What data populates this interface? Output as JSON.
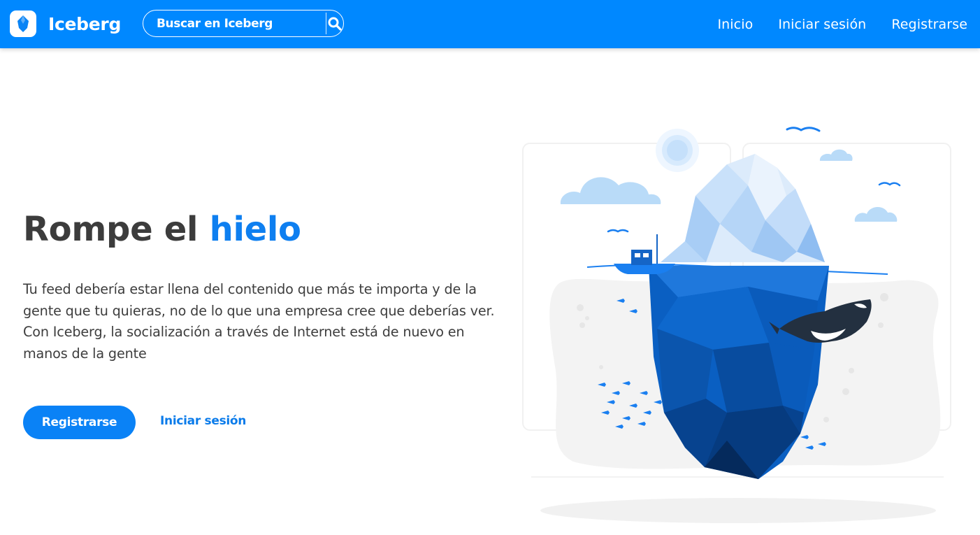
{
  "navbar": {
    "brand_name": "Iceberg",
    "logo_icon": "iceberg-logo-icon",
    "background_color": "#0088ff",
    "search": {
      "placeholder": "Buscar en Iceberg",
      "icon": "search-icon"
    },
    "links": [
      {
        "label": "Inicio"
      },
      {
        "label": "Iniciar sesión"
      },
      {
        "label": "Registrarse"
      }
    ]
  },
  "hero": {
    "title_prefix": "Rompe el",
    "title_accent": "hielo",
    "accent_color": "#0e7ff0",
    "description": "Tu feed debería estar llena del contenido que más te importa y de la gente que tu quieras, no de lo que una empresa cree que deberías ver. Con Iceberg, la socialización a través de Internet está de nuevo en manos de la gente",
    "primary_button": "Registrarse",
    "secondary_link": "Iniciar sesión"
  },
  "illustration": {
    "subject": "iceberg-illustration",
    "colors": {
      "ice_light": "#dcebfb",
      "ice_mid": "#b5d5f7",
      "water_deep": "#0a5fc2",
      "water_dark": "#063b7f",
      "sky_elements": "#a9d0f5"
    }
  }
}
